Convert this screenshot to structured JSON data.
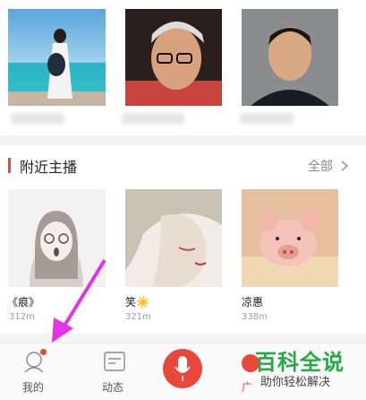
{
  "top_anchors": [
    {
      "photo": "woman-in-white-dress-by-sea"
    },
    {
      "photo": "man-with-glasses"
    },
    {
      "photo": "man-in-suit"
    }
  ],
  "nearby": {
    "title": "附近主播",
    "more_label": "全部",
    "anchors": [
      {
        "name": "《痕》",
        "distance": "312m"
      },
      {
        "name": "笑☀️",
        "distance": "321m"
      },
      {
        "name": "凉惠",
        "distance": "338m"
      }
    ]
  },
  "tabbar": {
    "items": [
      {
        "label": "我的",
        "icon": "profile-icon"
      },
      {
        "label": "动态",
        "icon": "feed-icon"
      },
      {
        "label": "",
        "icon": "microphone-icon"
      },
      {
        "label": "广",
        "icon": "broadcast-icon"
      }
    ]
  },
  "watermark": {
    "main": "百科全说",
    "sub": "助你轻松解决"
  },
  "colors": {
    "accent": "#e8473a",
    "annotation_arrow": "#e433e6",
    "watermark": "#27a845"
  }
}
